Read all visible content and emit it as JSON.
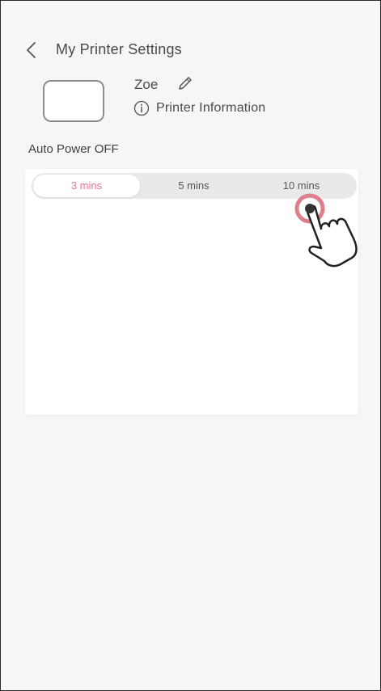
{
  "header": {
    "title": "My Printer Settings",
    "back_icon": "chevron-left-icon"
  },
  "printer": {
    "name": "Zoe",
    "edit_icon": "pencil-icon",
    "info_icon": "info-circle-icon",
    "info_label": "Printer Information"
  },
  "auto_power": {
    "label": "Auto Power OFF",
    "options": [
      "3 mins",
      "5 mins",
      "10 mins"
    ],
    "selected": "3 mins",
    "tap_hint_icon": "hand-pointer-icon"
  },
  "colors": {
    "accent": "#e8739a",
    "background": "#f6f6f6",
    "panel": "#ffffff",
    "segment_track": "#e9e9e9",
    "tap_ring": "#e07f8c"
  }
}
